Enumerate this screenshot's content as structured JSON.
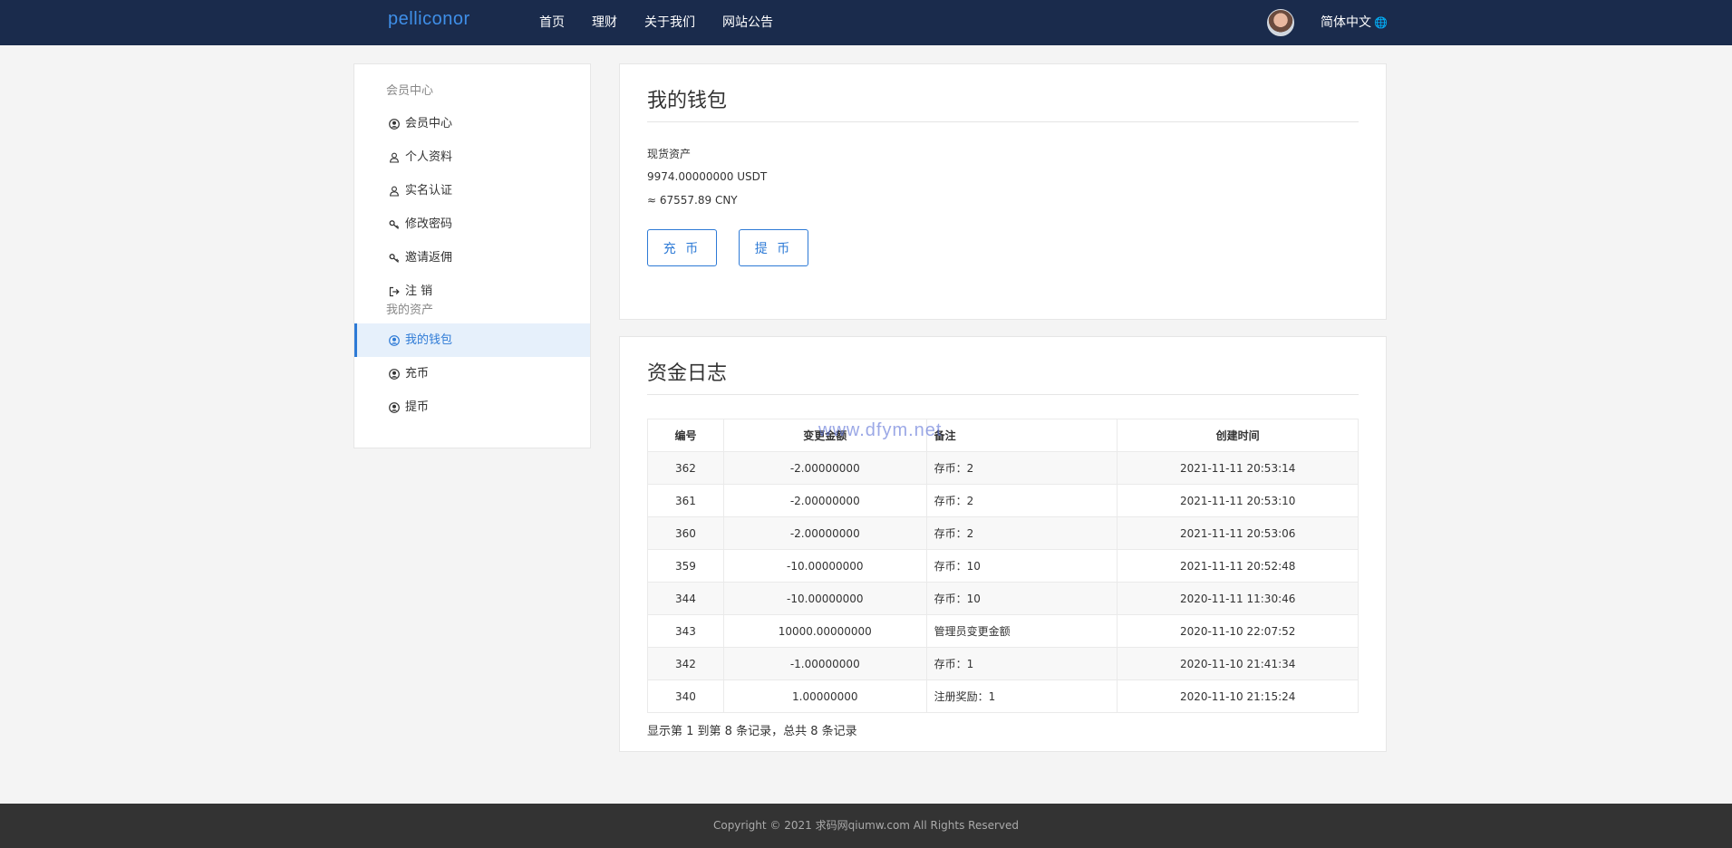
{
  "header": {
    "brand": "pelliconor",
    "nav": [
      "首页",
      "理财",
      "关于我们",
      "网站公告"
    ],
    "language": "简体中文"
  },
  "sidebar": {
    "group1": "会员中心",
    "items1": [
      {
        "label": "会员中心",
        "icon": "user-circle-icon"
      },
      {
        "label": "个人资料",
        "icon": "user-icon"
      },
      {
        "label": "实名认证",
        "icon": "user-icon"
      },
      {
        "label": "修改密码",
        "icon": "key-icon"
      },
      {
        "label": "邀请返佣",
        "icon": "key-icon"
      },
      {
        "label": "注 销",
        "icon": "sign-out-icon"
      }
    ],
    "group2": "我的资产",
    "items2": [
      {
        "label": "我的钱包",
        "icon": "user-circle-icon",
        "active": true
      },
      {
        "label": "充币",
        "icon": "user-circle-icon"
      },
      {
        "label": "提币",
        "icon": "user-circle-icon"
      }
    ]
  },
  "wallet": {
    "title": "我的钱包",
    "asset_label": "现货资产",
    "balance": "9974.00000000 USDT",
    "cny": "≈ 67557.89 CNY",
    "deposit_btn": "充 币",
    "withdraw_btn": "提 币"
  },
  "log": {
    "title": "资金日志",
    "columns": [
      "编号",
      "变更金额",
      "备注",
      "创建时间"
    ],
    "watermark": "www.dfym.net",
    "rows": [
      [
        "362",
        "-2.00000000",
        "存币：2",
        "2021-11-11 20:53:14"
      ],
      [
        "361",
        "-2.00000000",
        "存币：2",
        "2021-11-11 20:53:10"
      ],
      [
        "360",
        "-2.00000000",
        "存币：2",
        "2021-11-11 20:53:06"
      ],
      [
        "359",
        "-10.00000000",
        "存币：10",
        "2021-11-11 20:52:48"
      ],
      [
        "344",
        "-10.00000000",
        "存币：10",
        "2020-11-11 11:30:46"
      ],
      [
        "343",
        "10000.00000000",
        "管理员变更金额",
        "2020-11-10 22:07:52"
      ],
      [
        "342",
        "-1.00000000",
        "存币：1",
        "2020-11-10 21:41:34"
      ],
      [
        "340",
        "1.00000000",
        "注册奖励：1",
        "2020-11-10 21:15:24"
      ]
    ],
    "summary": "显示第 1 到第 8 条记录，总共 8 条记录"
  },
  "footer": "Copyright © 2021 求码网qiumw.com All Rights Reserved",
  "colors": {
    "header_bg": "#1a2b4c",
    "accent": "#2d7ad6",
    "footer_bg": "#333333"
  }
}
